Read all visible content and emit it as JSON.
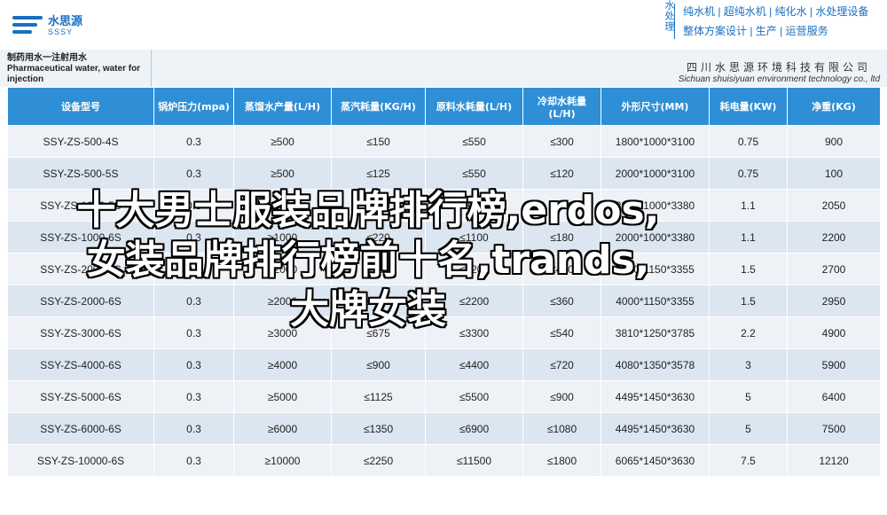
{
  "header": {
    "logo_cn": "水思源",
    "logo_en": "SSSY",
    "brand_vertical": "水处理",
    "services": [
      "纯水机 | 超纯水机 | 纯化水 | 水处理设备",
      "整体方案设计 | 生产 | 运营服务"
    ]
  },
  "band": {
    "left_title": "制药用水一注射用水 Pharmaceutical water, water for injection",
    "company_cn": "四川水思源环境科技有限公司",
    "company_en": "Sichuan shuisiyuan environment technology co., ltd"
  },
  "table": {
    "headers": [
      "设备型号",
      "锅炉压力(mpa)",
      "蒸馏水产量(L/H)",
      "蒸汽耗量(KG/H)",
      "原料水耗量(L/H)",
      "冷却水耗量(L/H)",
      "外形尺寸(MM)",
      "耗电量(KW)",
      "净重(KG)"
    ],
    "rows": [
      [
        "SSY-ZS-500-4S",
        "0.3",
        "≥500",
        "≤150",
        "≤550",
        "≤300",
        "1800*1000*3100",
        "0.75",
        "900"
      ],
      [
        "SSY-ZS-500-5S",
        "0.3",
        "≥500",
        "≤125",
        "≤550",
        "≤120",
        "2000*1000*3100",
        "0.75",
        "100"
      ],
      [
        "SSY-ZS-1000-5S",
        "0.3",
        "≥1000",
        "≤250",
        "≤1100",
        "≤240",
        "2000*1000*3380",
        "1.1",
        "2050"
      ],
      [
        "SSY-ZS-1000-6S",
        "0.3",
        "≥1000",
        "≤220",
        "≤1100",
        "≤180",
        "2000*1000*3380",
        "1.1",
        "2200"
      ],
      [
        "SSY-ZS-2000-5S",
        "0.3",
        "≥2000",
        "≤500",
        "≤2200",
        "≤480",
        "2000*1150*3355",
        "1.5",
        "2700"
      ],
      [
        "SSY-ZS-2000-6S",
        "0.3",
        "≥2000",
        "≤400",
        "≤2200",
        "≤360",
        "4000*1150*3355",
        "1.5",
        "2950"
      ],
      [
        "SSY-ZS-3000-6S",
        "0.3",
        "≥3000",
        "≤675",
        "≤3300",
        "≤540",
        "3810*1250*3785",
        "2.2",
        "4900"
      ],
      [
        "SSY-ZS-4000-6S",
        "0.3",
        "≥4000",
        "≤900",
        "≤4400",
        "≤720",
        "4080*1350*3578",
        "3",
        "5900"
      ],
      [
        "SSY-ZS-5000-6S",
        "0.3",
        "≥5000",
        "≤1125",
        "≤5500",
        "≤900",
        "4495*1450*3630",
        "5",
        "6400"
      ],
      [
        "SSY-ZS-6000-6S",
        "0.3",
        "≥6000",
        "≤1350",
        "≤6900",
        "≤1080",
        "4495*1450*3630",
        "5",
        "7500"
      ],
      [
        "SSY-ZS-10000-6S",
        "0.3",
        "≥10000",
        "≤2250",
        "≤11500",
        "≤1800",
        "6065*1450*3630",
        "7.5",
        "12120"
      ]
    ]
  },
  "overlay": {
    "line1": "十大男士服装品牌排行榜,erdos,",
    "line2": "女装品牌排行榜前十名,trands,",
    "line3": "大牌女装"
  },
  "colors": {
    "accent": "#2f8fd6",
    "brand": "#1a6fc0",
    "row_light": "#eef2f7",
    "row_dark": "#dbe6f1"
  }
}
